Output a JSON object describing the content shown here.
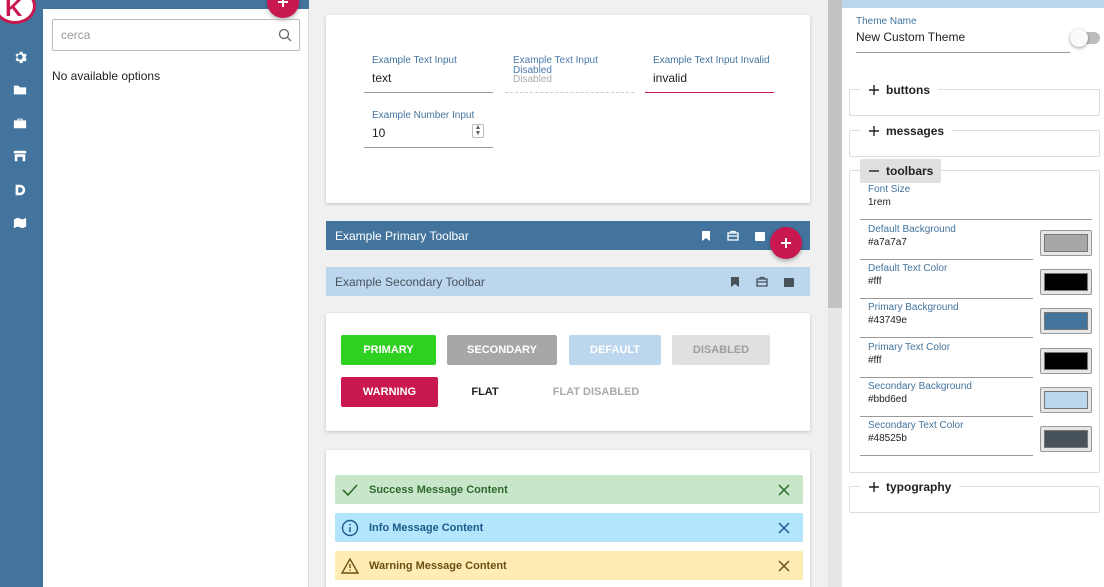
{
  "sidebar": {
    "logo_letter": "K",
    "icons": [
      "gear-icon",
      "folder-icon",
      "briefcase-icon",
      "store-icon",
      "d-letter-icon",
      "map-icon"
    ]
  },
  "options_panel": {
    "search_placeholder": "cerca",
    "empty_text": "No available options"
  },
  "inputs": {
    "text": {
      "label": "Example Text Input",
      "value": "text"
    },
    "disabled": {
      "label": "Example Text Input Disabled",
      "value": "Disabled"
    },
    "invalid": {
      "label": "Example Text Input Invalid",
      "value": "invalid"
    },
    "number": {
      "label": "Example Number Input",
      "value": "10"
    }
  },
  "toolbars": {
    "primary_title": "Example Primary Toolbar",
    "secondary_title": "Example Secondary Toolbar"
  },
  "buttons": {
    "primary": "PRIMARY",
    "secondary": "SECONDARY",
    "default": "DEFAULT",
    "disabled": "DISABLED",
    "warning": "WARNING",
    "flat": "FLAT",
    "flat_disabled": "FLAT DISABLED"
  },
  "messages": {
    "success": "Success Message Content",
    "info": "Info Message Content",
    "warning": "Warning Message Content"
  },
  "theme": {
    "name_label": "Theme Name",
    "name_value": "New Custom Theme",
    "sections": {
      "buttons": "buttons",
      "messages": "messages",
      "toolbars": "toolbars",
      "typography": "typography"
    },
    "toolbar_props": {
      "font_size": {
        "label": "Font Size",
        "value": "1rem"
      },
      "default_bg": {
        "label": "Default Background",
        "value": "#a7a7a7"
      },
      "default_text": {
        "label": "Default Text Color",
        "value": "#fff"
      },
      "primary_bg": {
        "label": "Primary Background",
        "value": "#43749e"
      },
      "primary_text": {
        "label": "Primary Text Color",
        "value": "#fff"
      },
      "secondary_bg": {
        "label": "Secondary Background",
        "value": "#bbd6ed"
      },
      "secondary_text": {
        "label": "Secondary Text Color",
        "value": "#48525b"
      }
    }
  },
  "colors": {
    "rail": "#43749e",
    "accent": "#c8184f",
    "primary_button": "#2ed11f",
    "secondary_button": "#a7a7a7",
    "success_bg": "#c8e6c9",
    "info_bg": "#b3e5fc",
    "warning_bg": "#ffecb3"
  }
}
